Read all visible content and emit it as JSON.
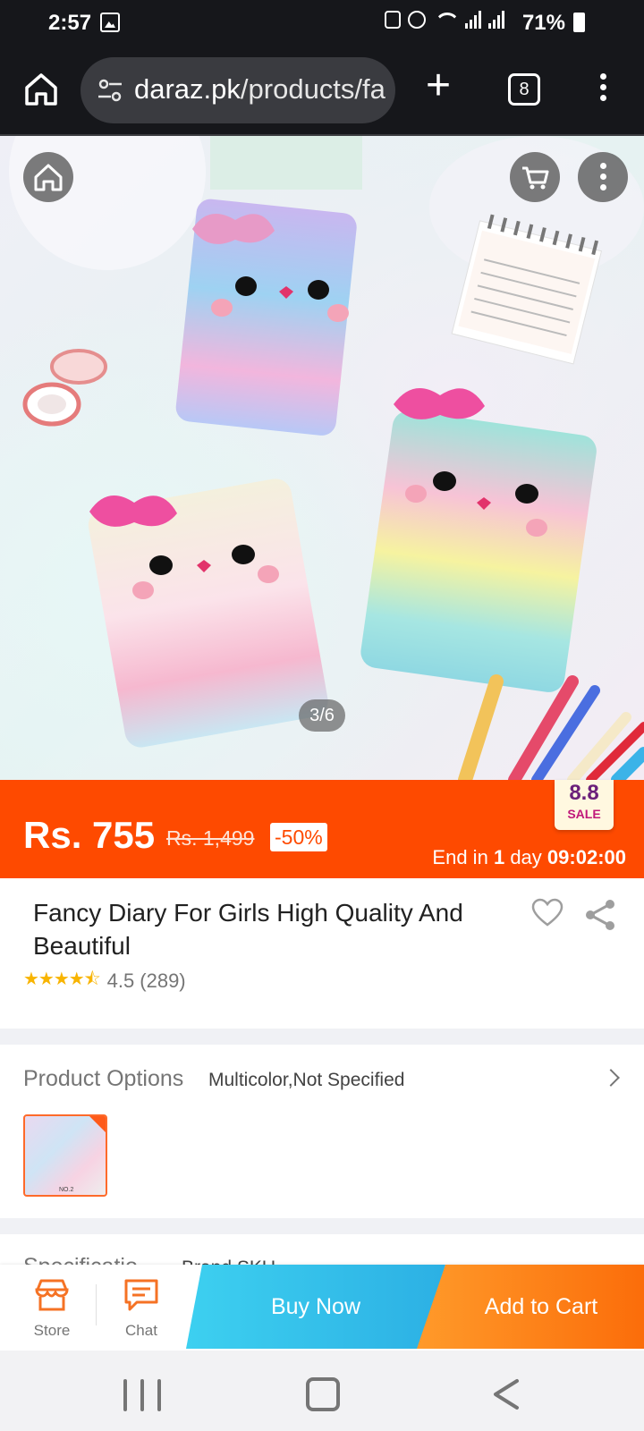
{
  "status_bar": {
    "time": "2:57",
    "battery": "71%"
  },
  "browser": {
    "url_host": "daraz.pk",
    "url_path": "/products/fa",
    "tab_count": "8"
  },
  "gallery": {
    "counter": "3/6"
  },
  "price": {
    "current": "Rs. 755",
    "original": "Rs. 1,499",
    "discount": "-50%",
    "sale_badge_number": "8.8",
    "sale_badge_text": "SALE",
    "countdown_prefix": "End in",
    "countdown_days": "1",
    "countdown_unit": "day",
    "countdown_time": "09:02:00"
  },
  "product": {
    "title": "Fancy Diary For Girls High Quality And Beautiful",
    "rating": "4.5",
    "review_count": "(289)",
    "stars": "★★★★⯪"
  },
  "options": {
    "label": "Product Options",
    "value": "Multicolor,Not Specified",
    "thumbnail_label": "NO.2"
  },
  "specification": {
    "label": "Specificatio",
    "value": "Brand,SKU"
  },
  "actions": {
    "store": "Store",
    "chat": "Chat",
    "buy_now": "Buy Now",
    "add_to_cart": "Add to Cart"
  },
  "colors": {
    "brand_orange": "#fe4a00",
    "buy_now_blue": "#2cb0e4",
    "add_cart_orange": "#fb6d0a"
  }
}
